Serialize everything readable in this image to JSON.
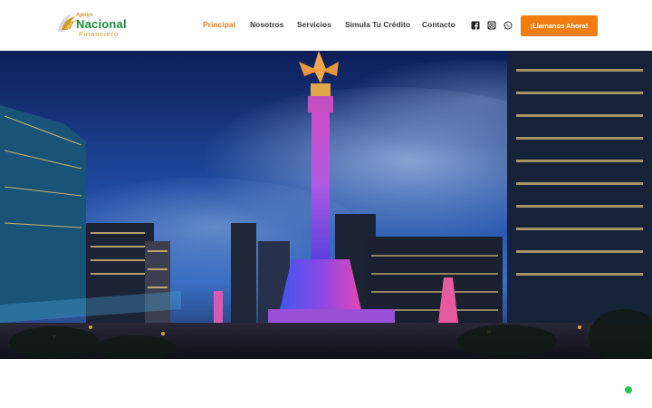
{
  "colors": {
    "accent": "#f07e14",
    "logo_gold": "#c99a2e",
    "logo_green": "#1f8a3c",
    "nav_text": "#3a3a3a",
    "whatsapp_green": "#25c152"
  },
  "logo": {
    "small": "Apoyo",
    "main": "Nacional",
    "sub": "Financiero"
  },
  "nav": {
    "items": [
      {
        "label": "Principal",
        "active": true
      },
      {
        "label": "Nosotros",
        "active": false
      },
      {
        "label": "Servicios",
        "active": false
      },
      {
        "label": "Simula Tu Crédito",
        "active": false
      },
      {
        "label": "Contacto",
        "active": false
      }
    ]
  },
  "social": {
    "icons": [
      "facebook-icon",
      "instagram-icon",
      "whatsapp-icon"
    ]
  },
  "cta": {
    "label": "¡Llamanos Ahora!"
  },
  "hero": {
    "icon": "angel-de-la-independencia-photo"
  },
  "chat": {
    "icon": "whatsapp-chat-icon"
  }
}
